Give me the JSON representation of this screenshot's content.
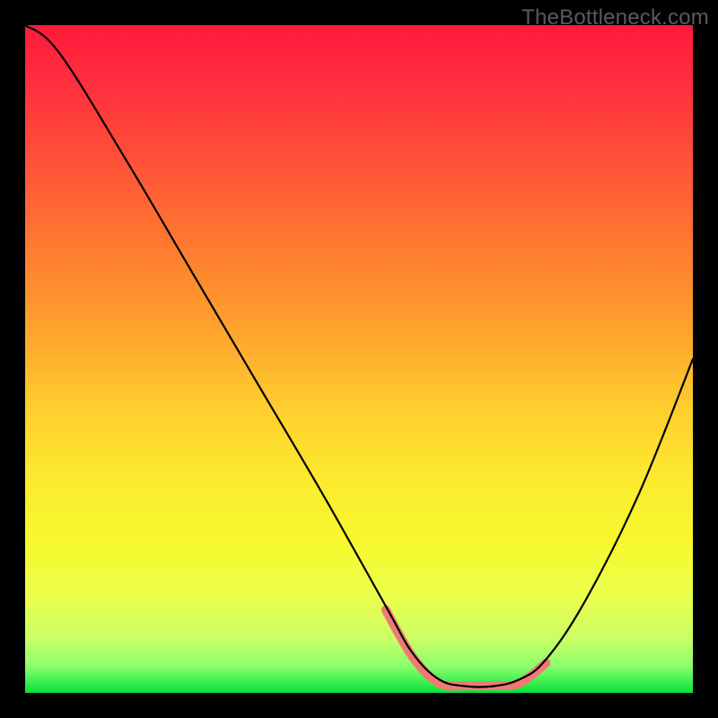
{
  "watermark": "TheBottleneck.com",
  "colors": {
    "background": "#000000",
    "gradient_top": "#ff1a3a",
    "gradient_mid": "#ffd02e",
    "gradient_bottom": "#06e23c",
    "curve": "#000000",
    "highlight": "#ef7a74"
  },
  "chart_data": {
    "type": "line",
    "title": "",
    "xlabel": "",
    "ylabel": "",
    "xlim": [
      0,
      100
    ],
    "ylim": [
      0,
      100
    ],
    "grid": false,
    "legend": false,
    "annotations": [],
    "series": [
      {
        "name": "bottleneck-curve",
        "x": [
          0,
          5,
          15,
          25,
          35,
          45,
          54,
          58,
          62,
          66,
          70,
          74,
          78,
          84,
          92,
          100
        ],
        "values": [
          100,
          96,
          80,
          63,
          46,
          29,
          13,
          6,
          2,
          1,
          1,
          2,
          5,
          14,
          30,
          50
        ]
      }
    ],
    "highlight_range_x": [
      56,
      74
    ]
  }
}
